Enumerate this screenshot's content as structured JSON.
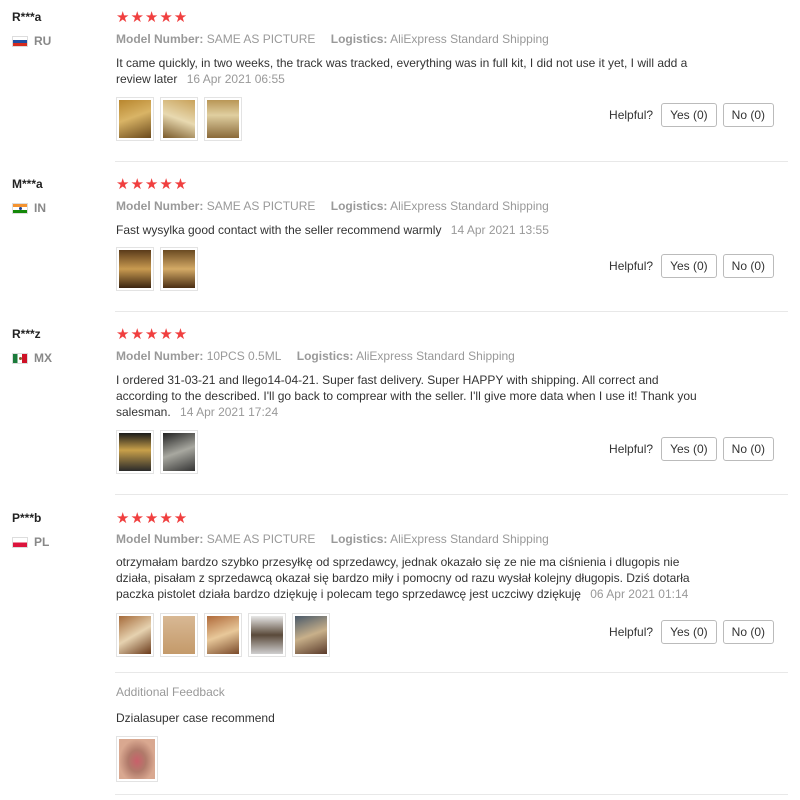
{
  "labels": {
    "model_number": "Model Number:",
    "logistics": "Logistics:",
    "helpful": "Helpful?",
    "additional_feedback": "Additional Feedback"
  },
  "stars_glyph": "★★★★★",
  "reviews": [
    {
      "user": "R***a",
      "country": "RU",
      "model": "SAME AS PICTURE",
      "logistics": "AliExpress Standard Shipping",
      "text": "It came quickly, in two weeks, the track was tracked, everything was in full kit, I did not use it yet, I will add a review later",
      "date": "16 Apr 2021 06:55",
      "yes": "Yes (0)",
      "no": "No (0)"
    },
    {
      "user": "M***a",
      "country": "IN",
      "model": "SAME AS PICTURE",
      "logistics": "AliExpress Standard Shipping",
      "text": "Fast wysylka good contact with the seller recommend warmly",
      "date": "14 Apr 2021 13:55",
      "yes": "Yes (0)",
      "no": "No (0)"
    },
    {
      "user": "R***z",
      "country": "MX",
      "model": "10PCS 0.5ML",
      "logistics": "AliExpress Standard Shipping",
      "text": "I ordered 31-03-21 and llego14-04-21. Super fast delivery. Super HAPPY with shipping. All correct and according to the described. I'll go back to comprear with the seller. I'll give more data when I use it! Thank you salesman.",
      "date": "14 Apr 2021 17:24",
      "yes": "Yes (0)",
      "no": "No (0)"
    },
    {
      "user": "P***b",
      "country": "PL",
      "model": "SAME AS PICTURE",
      "logistics": "AliExpress Standard Shipping",
      "text": "otrzymałam bardzo szybko przesyłkę od sprzedawcy, jednak okazało się ze nie ma ciśnienia i dlugopis nie działa, pisałam z sprzedawcą okazał się bardzo miły i pomocny od razu wysłał kolejny długopis. Dziś dotarła paczka pistolet działa bardzo dziękuję i polecam tego sprzedawcę jest uczciwy dziękuję",
      "date": "06 Apr 2021 01:14",
      "yes": "Yes (0)",
      "no": "No (0)",
      "additional_feedback": "Dzialasuper case recommend"
    }
  ]
}
